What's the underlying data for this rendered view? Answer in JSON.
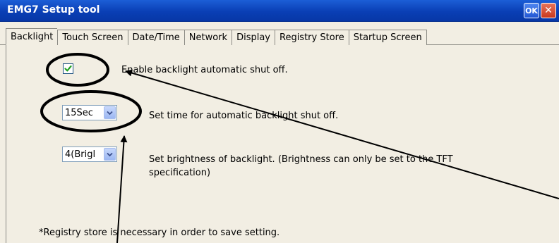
{
  "window": {
    "title": "EMG7 Setup tool",
    "ok_label": "OK",
    "close_label": "✕"
  },
  "tabs": [
    {
      "label": "Backlight",
      "active": true
    },
    {
      "label": "Touch Screen",
      "active": false
    },
    {
      "label": "Date/Time",
      "active": false
    },
    {
      "label": "Network",
      "active": false
    },
    {
      "label": "Display",
      "active": false
    },
    {
      "label": "Registry Store",
      "active": false
    },
    {
      "label": "Startup Screen",
      "active": false
    }
  ],
  "backlight": {
    "auto_shutoff_checked": true,
    "auto_shutoff_label": "Enable backlight automatic shut off.",
    "shutoff_time_value": "15Sec",
    "shutoff_time_label": "Set time for automatic backlight shut off.",
    "brightness_value": "4(Brigl",
    "brightness_label": "Set brightness of backlight. (Brightness can only be set to the TFT specification)",
    "note": "*Registry store is necessary in order to save setting."
  },
  "colors": {
    "titlebar": "#0a3fb5",
    "panel": "#f2eee3",
    "checkmark": "#21a121"
  },
  "icons": [
    "ok-icon",
    "close-icon",
    "check-icon",
    "chevron-down-icon"
  ]
}
